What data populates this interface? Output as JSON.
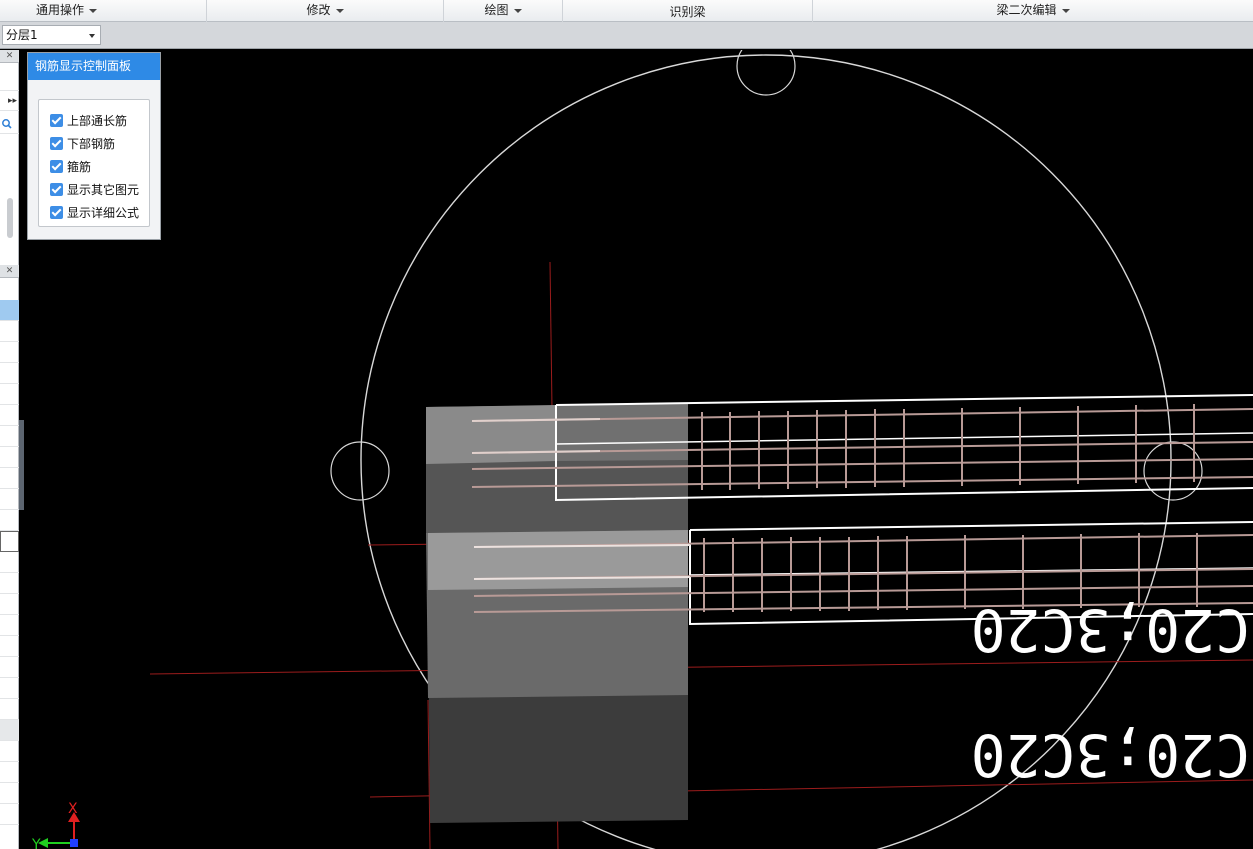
{
  "menubar": {
    "general": "通用操作",
    "modify": "修改",
    "draw": "绘图",
    "recognize": "识别梁",
    "beam_secondary": "梁二次编辑"
  },
  "toolbar": {
    "layer_value": "分层1"
  },
  "panel": {
    "title": "钢筋显示控制面板",
    "options": [
      {
        "label": "上部通长筋",
        "checked": true
      },
      {
        "label": "下部钢筋",
        "checked": true
      },
      {
        "label": "箍筋",
        "checked": true
      },
      {
        "label": "显示其它图元",
        "checked": true
      },
      {
        "label": "显示详细公式",
        "checked": true
      }
    ]
  },
  "canvas": {
    "beam_label_1": "C20;3C20",
    "beam_label_2": "C20;3C20",
    "axis_x": "X",
    "axis_y": "Y"
  },
  "icons": {
    "close": "close-icon",
    "expand": "double-chevron-right-icon",
    "search": "search-icon",
    "dropdown": "chevron-down-icon"
  },
  "colors": {
    "panel_title_bg": "#2e8ae6",
    "checkbox": "#3d8ee6",
    "axis_line": "#9b1c1c",
    "rebar": "#b89a96",
    "beam_outline": "#ffffff"
  }
}
